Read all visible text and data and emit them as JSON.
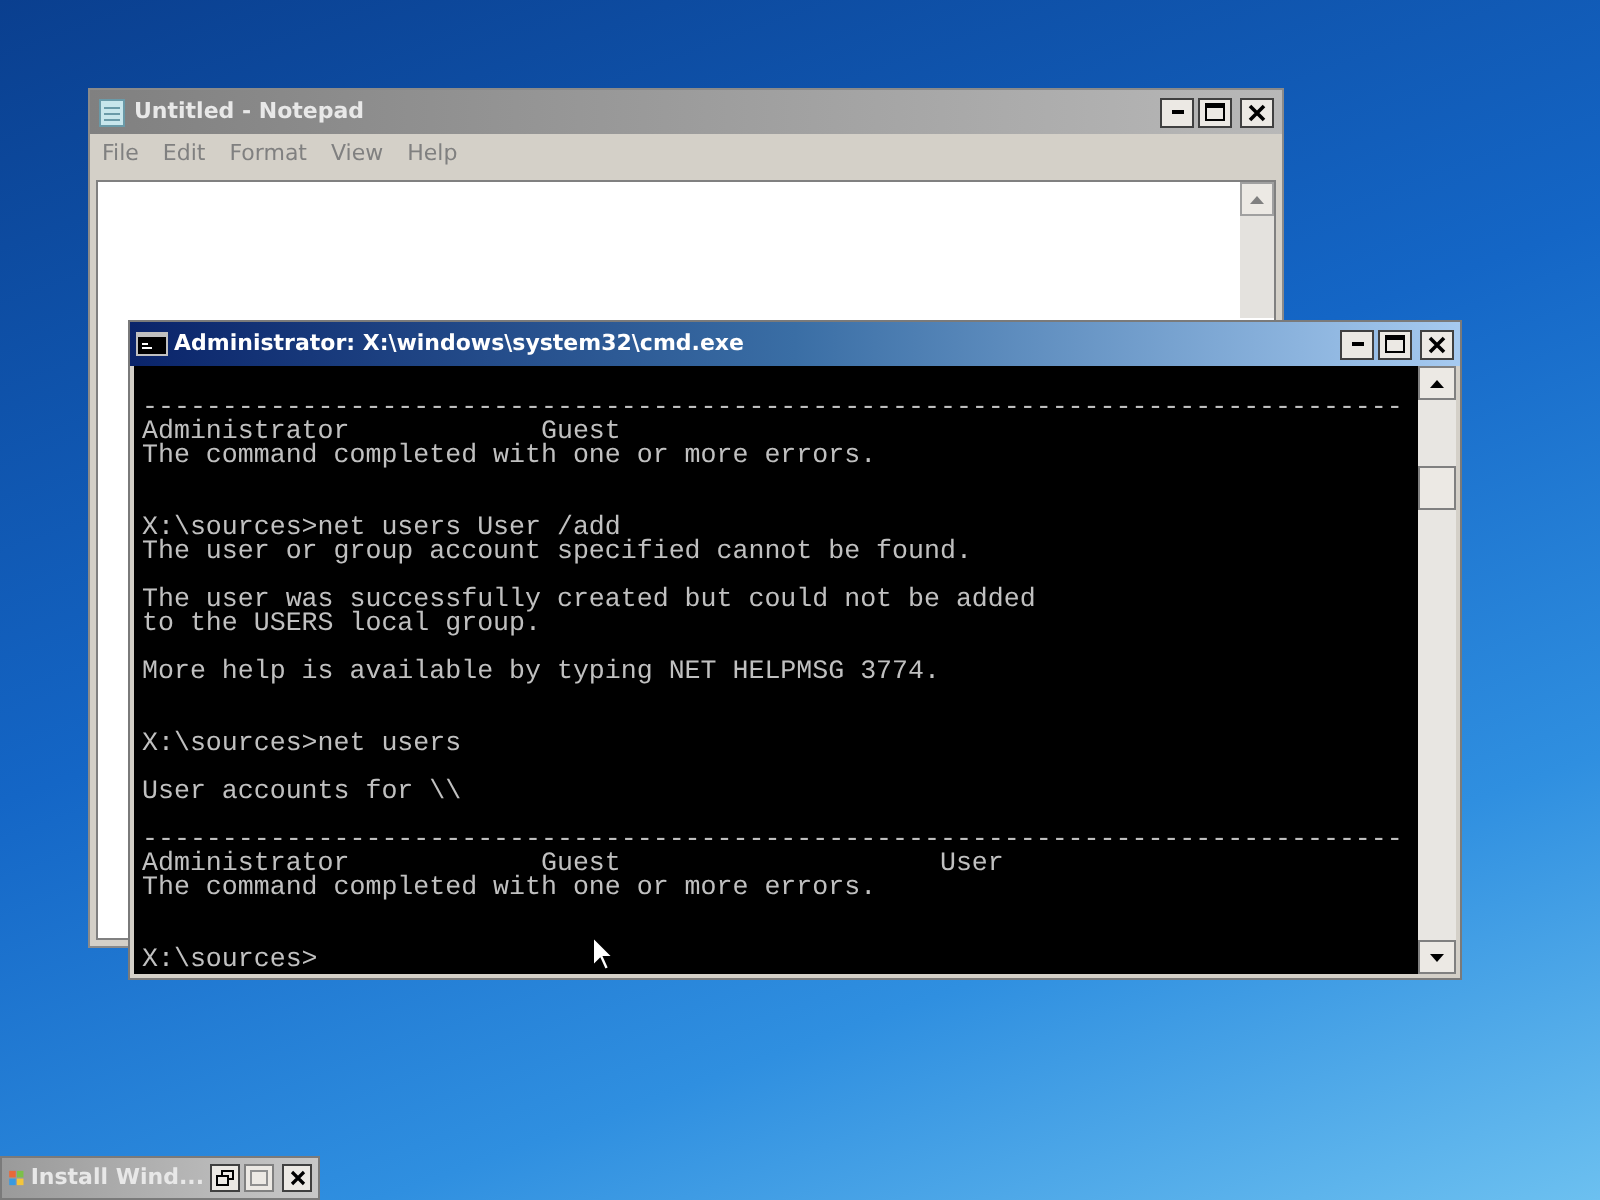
{
  "notepad": {
    "title": "Untitled - Notepad",
    "menu": [
      "File",
      "Edit",
      "Format",
      "View",
      "Help"
    ]
  },
  "console": {
    "title": "Administrator: X:\\windows\\system32\\cmd.exe",
    "lines": [
      {
        "kind": "text",
        "text": "-------------------------------------------------------------------------------"
      },
      {
        "kind": "text",
        "text": "Administrator            Guest"
      },
      {
        "kind": "text",
        "text": "The command completed with one or more errors."
      },
      {
        "kind": "blank"
      },
      {
        "kind": "blank"
      },
      {
        "kind": "text",
        "text": "X:\\sources>net users User /add"
      },
      {
        "kind": "text",
        "text": "The user or group account specified cannot be found."
      },
      {
        "kind": "blank"
      },
      {
        "kind": "text",
        "text": "The user was successfully created but could not be added"
      },
      {
        "kind": "text",
        "text": "to the USERS local group."
      },
      {
        "kind": "blank"
      },
      {
        "kind": "text",
        "text": "More help is available by typing NET HELPMSG 3774."
      },
      {
        "kind": "blank"
      },
      {
        "kind": "blank"
      },
      {
        "kind": "text",
        "text": "X:\\sources>net users"
      },
      {
        "kind": "blank"
      },
      {
        "kind": "text",
        "text": "User accounts for \\\\"
      },
      {
        "kind": "blank"
      },
      {
        "kind": "text",
        "text": "-------------------------------------------------------------------------------"
      },
      {
        "kind": "text",
        "text": "Administrator            Guest                    User"
      },
      {
        "kind": "text",
        "text": "The command completed with one or more errors."
      },
      {
        "kind": "blank"
      },
      {
        "kind": "blank"
      },
      {
        "kind": "text",
        "text": "X:\\sources>"
      }
    ]
  },
  "taskbar_window": {
    "title": "Install Wind..."
  }
}
